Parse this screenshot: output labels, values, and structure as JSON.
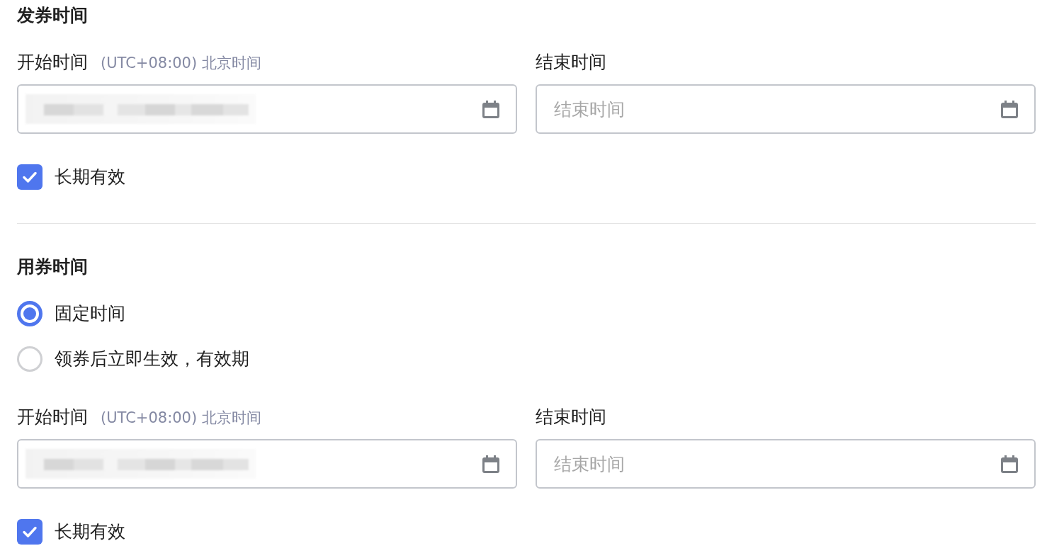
{
  "sections": [
    {
      "title": "发券时间",
      "start": {
        "label": "开始时间",
        "hint": "(UTC+08:00) 北京时间",
        "value_blurred": true
      },
      "end": {
        "label": "结束时间",
        "placeholder": "结束时间"
      },
      "long_term": {
        "label": "长期有效",
        "checked": true
      }
    },
    {
      "title": "用券时间",
      "modes": [
        {
          "label": "固定时间",
          "selected": true
        },
        {
          "label": "领券后立即生效，有效期",
          "selected": false
        }
      ],
      "start": {
        "label": "开始时间",
        "hint": "(UTC+08:00) 北京时间",
        "value_blurred": true
      },
      "end": {
        "label": "结束时间",
        "placeholder": "结束时间"
      },
      "long_term": {
        "label": "长期有效",
        "checked": true
      }
    }
  ]
}
